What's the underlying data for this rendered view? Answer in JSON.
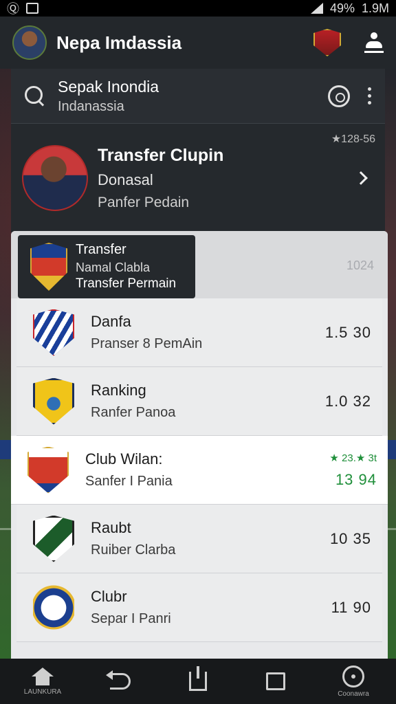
{
  "status_bar": {
    "left_text": "Ⓠ",
    "battery": "49%",
    "time": "1.9M"
  },
  "header": {
    "title": "Nepa Imdassia"
  },
  "search": {
    "value": "Sepak Inondia",
    "subtitle": "Indanassia"
  },
  "featured": {
    "title": "Transfer Clupin",
    "line1": "Donasal",
    "line2": "Panfer Pedain",
    "meta": "★128-56"
  },
  "tooltip": {
    "title": "Transfer",
    "line1": "Namal Clabla",
    "line2": "Transfer Permain",
    "value": "1024"
  },
  "rows": [
    {
      "title": "Danfa",
      "subtitle": "Pranser 8 PemAin",
      "value": "1.5 30"
    },
    {
      "title": "Ranking",
      "subtitle": "Ranfer Panoa",
      "value": "1.0 32"
    },
    {
      "title": "Club Wilan:",
      "subtitle": "Sanfer I Pania",
      "value": "13 94",
      "stars": "★ 23.★ 3t"
    },
    {
      "title": "Raubt",
      "subtitle": "Ruiber Clarba",
      "value": "10 35"
    },
    {
      "title": "Clubr",
      "subtitle": "Separ I Panri",
      "value": "11 90"
    }
  ],
  "nav": {
    "home_label": "LAUNKURA",
    "last_label": "Coonawra"
  },
  "colors": {
    "accent_green": "#1f8f3a",
    "header_bg": "#23272b",
    "list_bg": "#e8e9eb"
  },
  "icons": [
    "search-icon",
    "zoom-icon",
    "more-icon",
    "profile-icon",
    "chevron-right-icon",
    "home-icon",
    "back-icon",
    "share-icon",
    "recent-icon",
    "circle-icon"
  ]
}
